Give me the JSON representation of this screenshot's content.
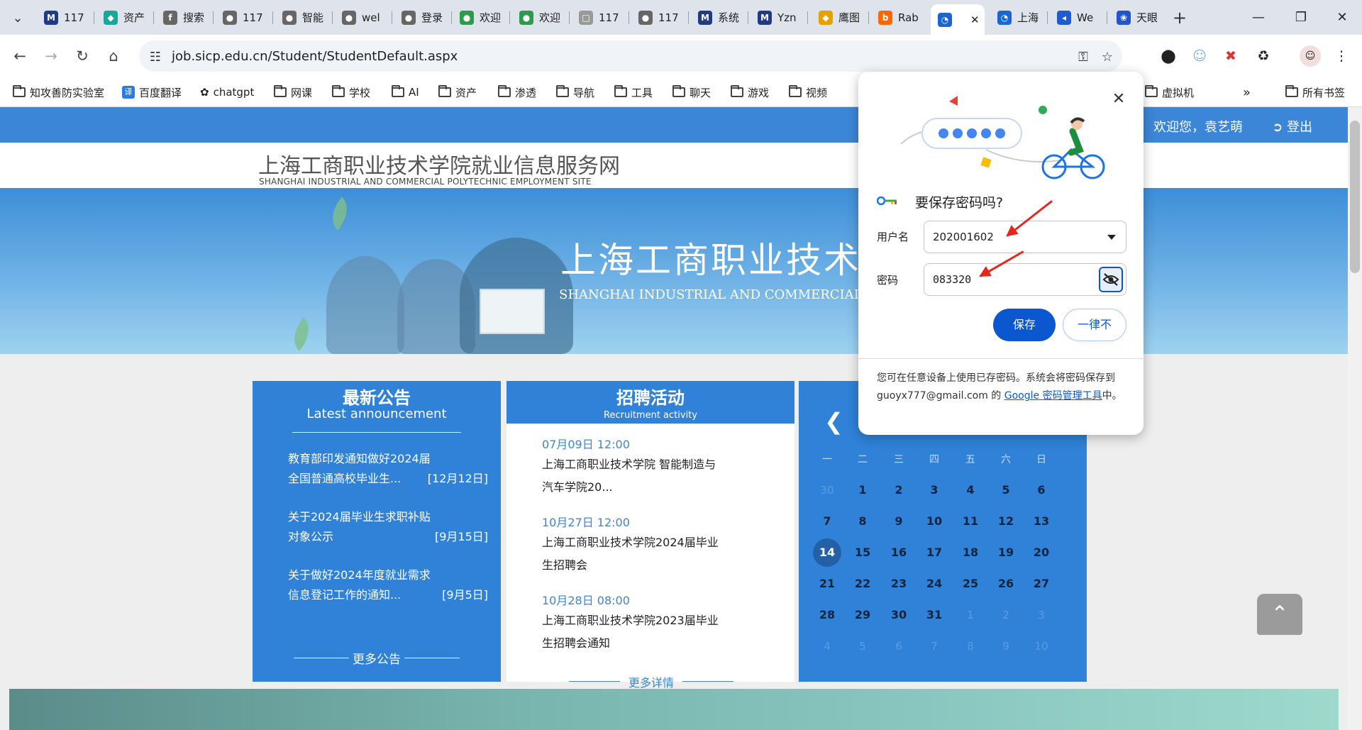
{
  "browser": {
    "tabs": [
      {
        "label": "117",
        "icon": "M",
        "color": "#1f3b87"
      },
      {
        "label": "资产",
        "icon": "◆",
        "color": "#1aa79b"
      },
      {
        "label": "搜索",
        "icon": "f",
        "color": "#666"
      },
      {
        "label": "117",
        "icon": "●",
        "color": "#666"
      },
      {
        "label": "智能",
        "icon": "●",
        "color": "#666"
      },
      {
        "label": "wel",
        "icon": "●",
        "color": "#666"
      },
      {
        "label": "登录",
        "icon": "●",
        "color": "#666"
      },
      {
        "label": "欢迎",
        "icon": "●",
        "color": "#2e9a4b"
      },
      {
        "label": "欢迎",
        "icon": "●",
        "color": "#2e9a4b"
      },
      {
        "label": "117",
        "icon": "□",
        "color": "#999"
      },
      {
        "label": "117",
        "icon": "●",
        "color": "#666"
      },
      {
        "label": "系统",
        "icon": "M",
        "color": "#1f3b87"
      },
      {
        "label": "Yzn",
        "icon": "M",
        "color": "#1f3b87"
      },
      {
        "label": "鹰图",
        "icon": "◆",
        "color": "#e6a100"
      },
      {
        "label": "Rab",
        "icon": "b",
        "color": "#ff6600"
      },
      {
        "label": "",
        "icon": "◔",
        "color": "#1a66d1",
        "active": true
      },
      {
        "label": "上海",
        "icon": "◔",
        "color": "#1a66d1"
      },
      {
        "label": "We",
        "icon": "◂",
        "color": "#1f5bd1"
      },
      {
        "label": "天眼",
        "icon": "❀",
        "color": "#2255cc"
      }
    ],
    "url": "job.sicp.edu.cn/Student/StudentDefault.aspx",
    "bookmarks": [
      "知攻善防实验室",
      "百度翻译",
      "chatgpt",
      "网课",
      "学校",
      "AI",
      "资产",
      "渗透",
      "导航",
      "工具",
      "聊天",
      "游戏",
      "视频",
      "虚拟机",
      "所有书签"
    ]
  },
  "site": {
    "welcome": "欢迎您，袁艺萌",
    "logout": "登出",
    "title_cn": "上海工商职业技术学院就业信息服务网",
    "title_en": "SHANGHAI INDUSTRIAL AND COMMERCIAL POLYTECHNIC EMPLOYMENT SITE",
    "banner_cn": "上海工商职业技术",
    "banner_en": "SHANGHAI INDUSTRIAL AND COMMERCIAL POLY"
  },
  "announcements": {
    "title": "最新公告",
    "subtitle": "Latest announcement",
    "items": [
      {
        "text": "教育部印发通知做好2024届全国普通高校毕业生...",
        "date": "[12月12日]"
      },
      {
        "text": "关于2024届毕业生求职补贴对象公示",
        "date": "[9月15日]"
      },
      {
        "text": "关于做好2024年度就业需求信息登记工作的通知...",
        "date": "[9月5日]"
      }
    ],
    "more": "更多公告"
  },
  "recruitment": {
    "title": "招聘活动",
    "subtitle": "Recruitment activity",
    "items": [
      {
        "date": "07月09日 12:00",
        "text": "上海工商职业技术学院 智能制造与汽车学院20..."
      },
      {
        "date": "10月27日 12:00",
        "text": "上海工商职业技术学院2024届毕业生招聘会"
      },
      {
        "date": "10月28日 08:00",
        "text": "上海工商职业技术学院2023届毕业生招聘会通知"
      }
    ],
    "more": "更多详情"
  },
  "calendar": {
    "weekdays": [
      "一",
      "二",
      "三",
      "四",
      "五",
      "六",
      "日"
    ],
    "today": "14",
    "weeks": [
      [
        "30",
        "1",
        "2",
        "3",
        "4",
        "5",
        "6"
      ],
      [
        "7",
        "8",
        "9",
        "10",
        "11",
        "12",
        "13"
      ],
      [
        "14",
        "15",
        "16",
        "17",
        "18",
        "19",
        "20"
      ],
      [
        "21",
        "22",
        "23",
        "24",
        "25",
        "26",
        "27"
      ],
      [
        "28",
        "29",
        "30",
        "31",
        "1",
        "2",
        "3"
      ],
      [
        "4",
        "5",
        "6",
        "7",
        "8",
        "9",
        "10"
      ]
    ]
  },
  "password_popup": {
    "title": "要保存密码吗?",
    "username_label": "用户名",
    "username_value": "202001602",
    "password_label": "密码",
    "password_value": "083320",
    "save": "保存",
    "never": "一律不",
    "footer_1": "您可在任意设备上使用已存密码。系统会将密码保存到 guoyx777@gmail.com 的 ",
    "footer_link": "Google 密码管理工具",
    "footer_2": "中。"
  }
}
